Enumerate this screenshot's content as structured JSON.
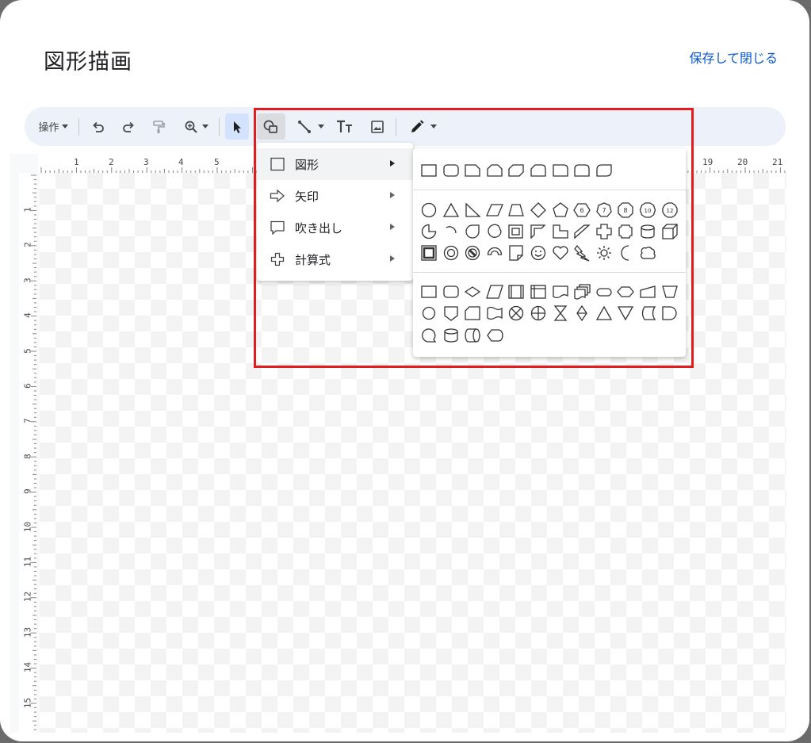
{
  "dialog": {
    "title": "図形描画",
    "save_close": "保存して閉じる"
  },
  "toolbar": {
    "actions_label": "操作",
    "buttons": [
      "undo-icon",
      "redo-icon",
      "paint-format-icon",
      "zoom-icon",
      "select-icon",
      "shape-icon",
      "line-icon",
      "text-box-icon",
      "image-icon",
      "pen-icon"
    ]
  },
  "ruler": {
    "horizontal": [
      "1",
      "2",
      "3",
      "4",
      "5",
      "19",
      "20",
      "21"
    ],
    "vertical": [
      "1",
      "2",
      "3",
      "4",
      "5",
      "6",
      "7",
      "8",
      "9",
      "10",
      "11",
      "12",
      "13",
      "14",
      "15"
    ]
  },
  "shape_menu": {
    "items": [
      {
        "label": "図形",
        "icon": "square-icon",
        "active": true
      },
      {
        "label": "矢印",
        "icon": "arrow-icon",
        "active": false
      },
      {
        "label": "吹き出し",
        "icon": "callout-icon",
        "active": false
      },
      {
        "label": "計算式",
        "icon": "plus-icon",
        "active": false
      }
    ]
  },
  "shapes_submenu": {
    "rows": [
      [
        "rectangle",
        "rounded-rectangle",
        "snip-corner",
        "snip-two",
        "snip-diagonal",
        "round-snip",
        "round-single",
        "round-two",
        "round-diagonal"
      ],
      [
        "oval",
        "triangle",
        "right-triangle",
        "parallelogram",
        "trapezoid",
        "diamond",
        "pentagon",
        "hexagon",
        "heptagon",
        "octagon",
        "decagon",
        "dodecagon"
      ],
      [
        "pie",
        "arc",
        "teardrop",
        "chord",
        "frame",
        "half-frame",
        "l-shape",
        "diagonal-stripe",
        "cross",
        "plaque",
        "can",
        "cube"
      ],
      [
        "bevel",
        "donut",
        "no-symbol",
        "block-arc",
        "folded-corner",
        "smiley",
        "heart",
        "lightning",
        "sun",
        "moon",
        "cloud"
      ],
      [
        "process",
        "alternate-process",
        "decision",
        "data",
        "predefined-process",
        "internal-storage",
        "document",
        "multidocument",
        "terminator",
        "preparation",
        "manual-input",
        "manual-operation"
      ],
      [
        "connector",
        "offpage-connector",
        "card",
        "punched-tape",
        "summing-junction",
        "or",
        "collate",
        "sort",
        "extract",
        "merge",
        "stored-data",
        "delay"
      ],
      [
        "sequential-access",
        "magnetic-disk",
        "direct-access",
        "display"
      ]
    ],
    "polygon_numbers": {
      "hexagon": "6",
      "heptagon": "7",
      "octagon": "8",
      "decagon": "10",
      "dodecagon": "12"
    }
  },
  "colors": {
    "accent": "#0b57d0",
    "toolbar_bg": "#edf2fa",
    "highlight": "#e11d1d",
    "selected": "#d3e3fd"
  }
}
